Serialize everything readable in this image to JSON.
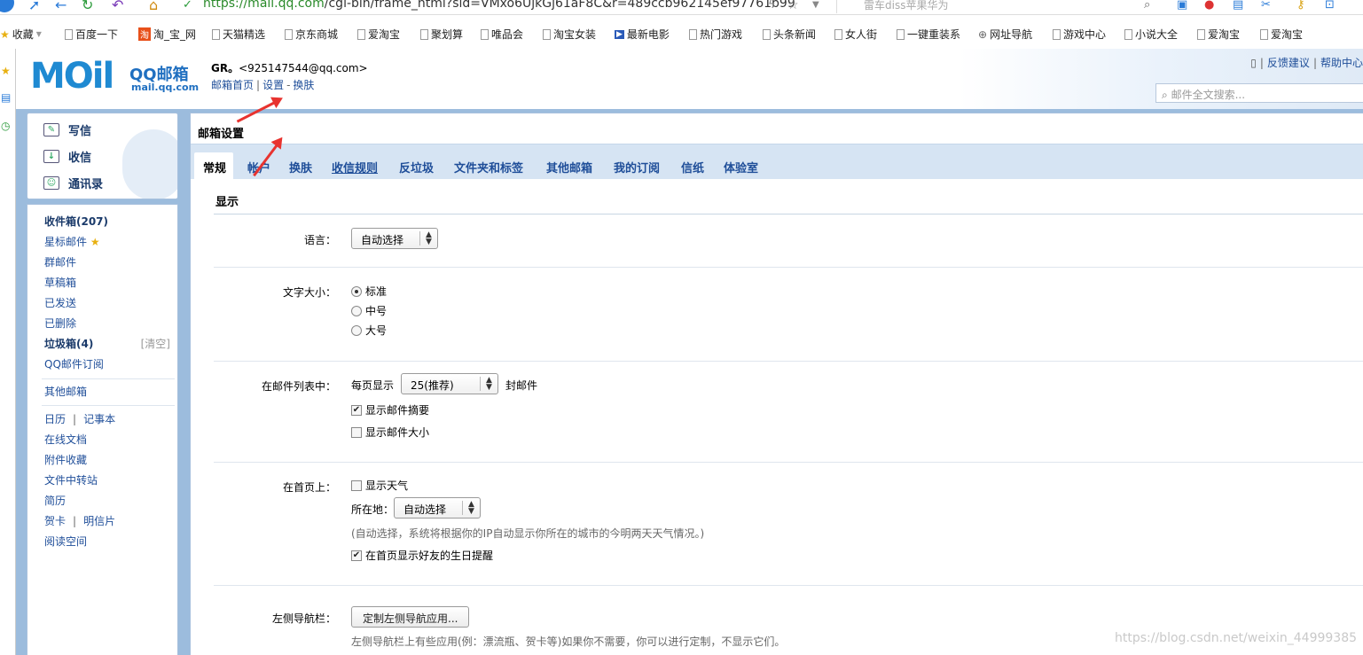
{
  "browser": {
    "url_host": "https://mail.qq.com",
    "url_path": "/cgi-bin/frame_html?sid=VMxo6UjkGj61aF8C&r=489ccb962145ef97761b99",
    "search_hint": "雷车diss苹果华为"
  },
  "bookmarks": [
    "收藏",
    "百度一下",
    "淘_宝_网",
    "天猫精选",
    "京东商城",
    "爱淘宝",
    "聚划算",
    "唯品会",
    "淘宝女装",
    "最新电影",
    "热门游戏",
    "头条新闻",
    "女人街",
    "一键重装系",
    "网址导航",
    "游戏中心",
    "小说大全",
    "爱淘宝",
    "爱淘宝"
  ],
  "header": {
    "logo_text": "MOil",
    "logo_sub1": "QQ邮箱",
    "logo_sub2": "mail.qq.com",
    "user_name": "GR。",
    "user_email": "<925147544@qq.com>",
    "link_home": "邮箱首页",
    "link_settings": "设置",
    "link_skin": "换肤",
    "link_feedback": "反馈建议",
    "link_help": "帮助中心",
    "search_placeholder": "邮件全文搜索..."
  },
  "quick": {
    "compose": "写信",
    "receive": "收信",
    "contacts": "通讯录"
  },
  "folders": {
    "inbox": "收件箱(207)",
    "starred": "星标邮件",
    "group": "群邮件",
    "drafts": "草稿箱",
    "sent": "已发送",
    "deleted": "已删除",
    "spam": "垃圾箱(4)",
    "spam_clear": "[清空]",
    "subscribe": "QQ邮件订阅",
    "other": "其他邮箱",
    "calendar": "日历",
    "notes": "记事本",
    "docs": "在线文档",
    "attachments": "附件收藏",
    "transfer": "文件中转站",
    "resume": "简历",
    "card": "贺卡",
    "postcard": "明信片",
    "reading": "阅读空间"
  },
  "settings": {
    "title": "邮箱设置",
    "tabs": [
      "常规",
      "帐户",
      "换肤",
      "收信规则",
      "反垃圾",
      "文件夹和标签",
      "其他邮箱",
      "我的订阅",
      "信纸",
      "体验室"
    ],
    "section": "显示",
    "language_label": "语言：",
    "language_value": "自动选择",
    "fontsize_label": "文字大小：",
    "fontsize_options": [
      "标准",
      "中号",
      "大号"
    ],
    "list_label": "在邮件列表中：",
    "per_page_prefix": "每页显示",
    "per_page_value": "25(推荐)",
    "per_page_suffix": "封邮件",
    "show_summary": "显示邮件摘要",
    "show_size": "显示邮件大小",
    "home_label": "在首页上：",
    "show_weather": "显示天气",
    "location_label": "所在地：",
    "location_value": "自动选择",
    "location_hint": "(自动选择，系统将根据你的IP自动显示你所在的城市的今明两天天气情况。)",
    "show_birthday": "在首页显示好友的生日提醒",
    "nav_label": "左侧导航栏：",
    "nav_button": "定制左侧导航应用...",
    "nav_hint": "左侧导航栏上有些应用(例：漂流瓶、贺卡等)如果你不需要，你可以进行定制，不显示它们。"
  },
  "watermark": "https://blog.csdn.net/weixin_44999385",
  "colors": {
    "accent": "#1f4e99",
    "frame": "#9cbcdd",
    "tabbar": "#d6e4f3",
    "annotation": "#e8332f"
  }
}
